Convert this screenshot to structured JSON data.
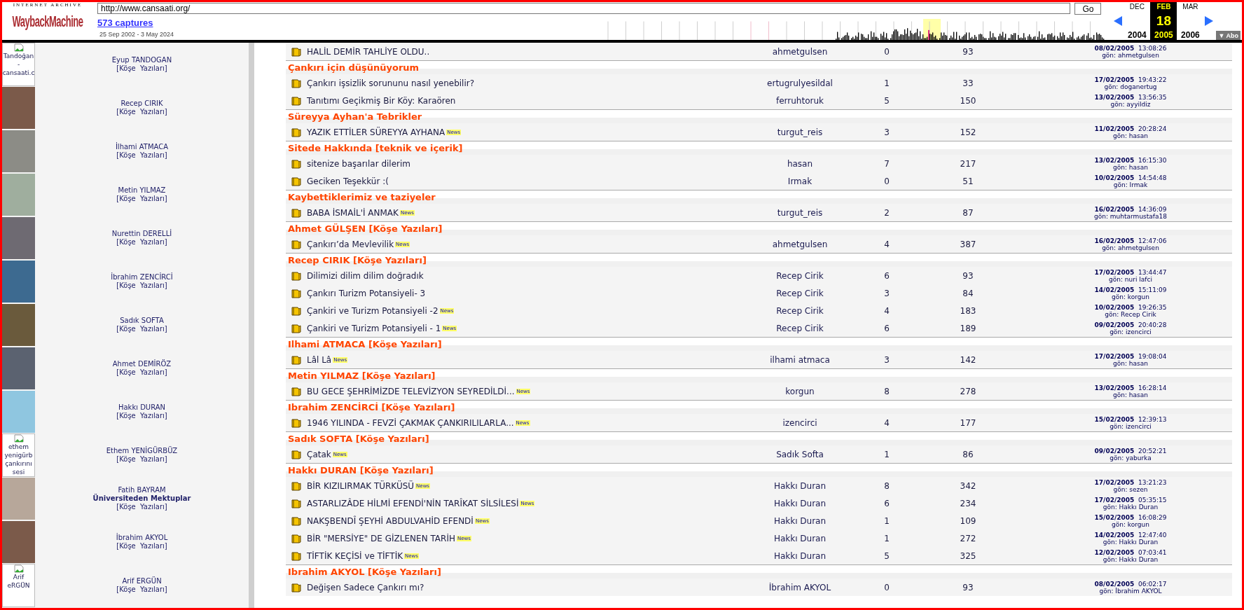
{
  "toolbar": {
    "brand_top": "INTERNET ARCHIVE",
    "brand": "WaybackMachine",
    "url": "http://www.cansaati.org/",
    "go": "Go",
    "captures": "573 captures",
    "range": "25 Sep 2002 - 3 May 2024",
    "calendar": {
      "months": [
        {
          "label": "DEC",
          "selected": false
        },
        {
          "label": "FEB",
          "selected": true
        },
        {
          "label": "MAR",
          "selected": false
        }
      ],
      "day": "18",
      "years": [
        {
          "label": "2004",
          "selected": false
        },
        {
          "label": "2005",
          "selected": true
        },
        {
          "label": "2006",
          "selected": false
        }
      ]
    },
    "about": "▼ Abo"
  },
  "sidebar": {
    "authors": [
      {
        "name": "Eyup TANDOGAN",
        "section": "[Köşe  Yazıları]",
        "photo": {
          "kind": "broken",
          "alt": [
            "Tandoğan",
            "-",
            "cansaati.c"
          ]
        }
      },
      {
        "name": "Recep CIRIK",
        "section": "[Köşe  Yazıları]",
        "photo": {
          "kind": "photo"
        }
      },
      {
        "name": "İlhami ATMACA",
        "section": "[Köşe  Yazıları]",
        "photo": {
          "kind": "photo"
        }
      },
      {
        "name": "Metin YILMAZ",
        "section": "[Köşe  Yazıları]",
        "photo": {
          "kind": "photo"
        }
      },
      {
        "name": "Nurettin DERELLİ",
        "section": "[Köşe  Yazıları]",
        "photo": {
          "kind": "photo"
        }
      },
      {
        "name": "İbrahim ZENCİRCİ",
        "section": "[Köşe  Yazıları]",
        "photo": {
          "kind": "photo"
        }
      },
      {
        "name": "Sadık SOFTA",
        "section": "[Köşe  Yazıları]",
        "photo": {
          "kind": "photo"
        }
      },
      {
        "name": "Ahmet DEMİRÖZ",
        "section": "[Köşe  Yazıları]",
        "photo": {
          "kind": "photo"
        }
      },
      {
        "name": "Hakkı DURAN",
        "section": "[Köşe  Yazıları]",
        "photo": {
          "kind": "photo"
        }
      },
      {
        "name": "Ethem YENİGÜRBÜZ",
        "section": "[Köşe  Yazıları]",
        "photo": {
          "kind": "broken",
          "alt": [
            "ethem",
            "yenigürb",
            "çankırını",
            "sesi"
          ]
        }
      },
      {
        "name": "Fatih BAYRAM",
        "subtitle": "Üniversiteden Mektuplar",
        "section": "[Köşe  Yazıları]",
        "photo": {
          "kind": "photo"
        }
      },
      {
        "name": "İbrahim AKYOL",
        "section": "[Köşe  Yazıları]",
        "photo": {
          "kind": "photo"
        }
      },
      {
        "name": "Arif ERGÜN",
        "section": "[Köşe  Yazıları]",
        "photo": {
          "kind": "broken",
          "alt": [
            "Arif",
            "eRGÜN"
          ]
        }
      }
    ]
  },
  "forum": {
    "groups": [
      {
        "threads": [
          {
            "title": "HALİL DEMİR TAHLİYE OLDU..",
            "author": "ahmetgulsen",
            "replies": "0",
            "views": "93",
            "date": "08/02/2005",
            "time": "13:08:26",
            "last_by": "gön: ahmetgulsen"
          }
        ]
      },
      {
        "title": "Çankırı için düşünüyorum",
        "threads": [
          {
            "title": "Çankırı işsizlik sorununu nasıl yenebilir?",
            "author": "ertugrulyesildal",
            "replies": "1",
            "views": "33",
            "date": "17/02/2005",
            "time": "19:43:22",
            "last_by": "gön: doganertug"
          },
          {
            "title": "Tanıtımı Geçikmiş Bir Köy: Karaören",
            "author": "ferruhtoruk",
            "replies": "5",
            "views": "150",
            "date": "13/02/2005",
            "time": "13:56:35",
            "last_by": "gön: ayyildiz"
          }
        ]
      },
      {
        "title": "Süreyya Ayhan'a Tebrikler",
        "threads": [
          {
            "title": "YAZIK ETTİLER SÜREYYA AYHANA",
            "badge": "News",
            "author": "turgut_reis",
            "replies": "3",
            "views": "152",
            "date": "11/02/2005",
            "time": "20:28:24",
            "last_by": "gön: hasan"
          }
        ]
      },
      {
        "title": "Sitede Hakkında [teknik ve içerik]",
        "threads": [
          {
            "title": "sitenize başarılar dilerim",
            "author": "hasan",
            "replies": "7",
            "views": "217",
            "date": "13/02/2005",
            "time": "16:15:30",
            "last_by": "gön: hasan"
          },
          {
            "title": "Geciken Teşekkür :(",
            "author": "Irmak",
            "replies": "0",
            "views": "51",
            "date": "10/02/2005",
            "time": "14:54:48",
            "last_by": "gön: Irmak"
          }
        ]
      },
      {
        "title": "Kaybettiklerimiz ve taziyeler",
        "threads": [
          {
            "title": "BABA İSMAİL'İ ANMAK",
            "badge": "News",
            "author": "turgut_reis",
            "replies": "2",
            "views": "87",
            "date": "16/02/2005",
            "time": "14:36:09",
            "last_by": "gön: muhtarmustafa18"
          }
        ]
      },
      {
        "title": "Ahmet GÜLŞEN [Köşe Yazıları]",
        "threads": [
          {
            "title": "Çankırı’da Mevlevilik",
            "badge": "News",
            "author": "ahmetgulsen",
            "replies": "4",
            "views": "387",
            "date": "16/02/2005",
            "time": "12:47:06",
            "last_by": "gön: ahmetgulsen"
          }
        ]
      },
      {
        "title": "Recep CIRIK [Köşe Yazıları]",
        "threads": [
          {
            "title": "Dilimizi dilim dilim doğradık",
            "author": "Recep Cirik",
            "replies": "6",
            "views": "93",
            "date": "17/02/2005",
            "time": "13:44:47",
            "last_by": "gön: nuri lafci"
          },
          {
            "title": "Çankırı Turizm Potansiyeli- 3",
            "author": "Recep Cirik",
            "replies": "3",
            "views": "84",
            "date": "14/02/2005",
            "time": "15:11:09",
            "last_by": "gön: korgun"
          },
          {
            "title": "Çankiri ve Turizm Potansiyeli -2",
            "badge": "News",
            "author": "Recep Cirik",
            "replies": "4",
            "views": "183",
            "date": "10/02/2005",
            "time": "19:26:35",
            "last_by": "gön: Recep Cirik"
          },
          {
            "title": "Çankiri ve Turizm Potansiyeli - 1",
            "badge": "News",
            "author": "Recep Cirik",
            "replies": "6",
            "views": "189",
            "date": "09/02/2005",
            "time": "20:40:28",
            "last_by": "gön: izencirci"
          }
        ]
      },
      {
        "title": "Ilhami ATMACA [Köşe Yazıları]",
        "threads": [
          {
            "title": "Lâl Lâ",
            "badge": "News",
            "author": "ilhami atmaca",
            "replies": "3",
            "views": "142",
            "date": "17/02/2005",
            "time": "19:08:04",
            "last_by": "gön: hasan"
          }
        ]
      },
      {
        "title": "Metin YILMAZ [Köşe Yazıları]",
        "threads": [
          {
            "title": "BU GECE ŞEHRİMİZDE TELEVİZYON SEYREDİLDİ...",
            "badge": "News",
            "author": "korgun",
            "replies": "8",
            "views": "278",
            "date": "13/02/2005",
            "time": "16:28:14",
            "last_by": "gön: hasan"
          }
        ]
      },
      {
        "title": "Ibrahim ZENCİRCİ [Köşe Yazıları]",
        "threads": [
          {
            "title": "1946 YILINDA - FEVZİ ÇAKMAK ÇANKIRILILARLA...",
            "badge": "News",
            "author": "izencirci",
            "replies": "4",
            "views": "177",
            "date": "15/02/2005",
            "time": "12:39:13",
            "last_by": "gön: izencirci"
          }
        ]
      },
      {
        "title": "Sadık SOFTA [Köşe Yazıları]",
        "threads": [
          {
            "title": "Çatak",
            "badge": "News",
            "author": "Sadık Softa",
            "replies": "1",
            "views": "86",
            "date": "09/02/2005",
            "time": "20:52:21",
            "last_by": "gön: yaburka"
          }
        ]
      },
      {
        "title": "Hakkı DURAN [Köşe Yazıları]",
        "threads": [
          {
            "title": "BİR KIZILIRMAK TÜRKÜSÜ",
            "badge": "News",
            "author": "Hakkı Duran",
            "replies": "8",
            "views": "342",
            "date": "17/02/2005",
            "time": "13:21:23",
            "last_by": "gön: sezen"
          },
          {
            "title": "ASTARLIZÂDE HİLMİ EFENDİ'NİN TARÎKAT SİLSİLESİ",
            "badge": "News",
            "author": "Hakkı Duran",
            "replies": "6",
            "views": "234",
            "date": "17/02/2005",
            "time": "05:35:15",
            "last_by": "gön: Hakkı Duran"
          },
          {
            "title": "NAKŞBENDÎ ŞEYHİ ABDULVAHİD EFENDİ",
            "badge": "News",
            "author": "Hakkı Duran",
            "replies": "1",
            "views": "109",
            "date": "15/02/2005",
            "time": "16:08:29",
            "last_by": "gön: korgun"
          },
          {
            "title": "BİR \"MERSİYE\" DE GİZLENEN TARİH",
            "badge": "News",
            "author": "Hakkı Duran",
            "replies": "1",
            "views": "272",
            "date": "14/02/2005",
            "time": "12:47:40",
            "last_by": "gön: Hakkı Duran"
          },
          {
            "title": "TİFTİK KEÇİSİ ve TİFTİK",
            "badge": "News",
            "author": "Hakkı Duran",
            "replies": "5",
            "views": "325",
            "date": "12/02/2005",
            "time": "07:03:41",
            "last_by": "gön: Hakkı Duran"
          }
        ]
      },
      {
        "title": "Ibrahim AKYOL [Köşe Yazıları]",
        "threads": [
          {
            "title": "Değişen Sadece Çankırı mı?",
            "author": "İbrahim AKYOL",
            "replies": "0",
            "views": "93",
            "date": "08/02/2005",
            "time": "06:02:17",
            "last_by": "gön: İbrahim AKYOL"
          }
        ]
      }
    ]
  }
}
